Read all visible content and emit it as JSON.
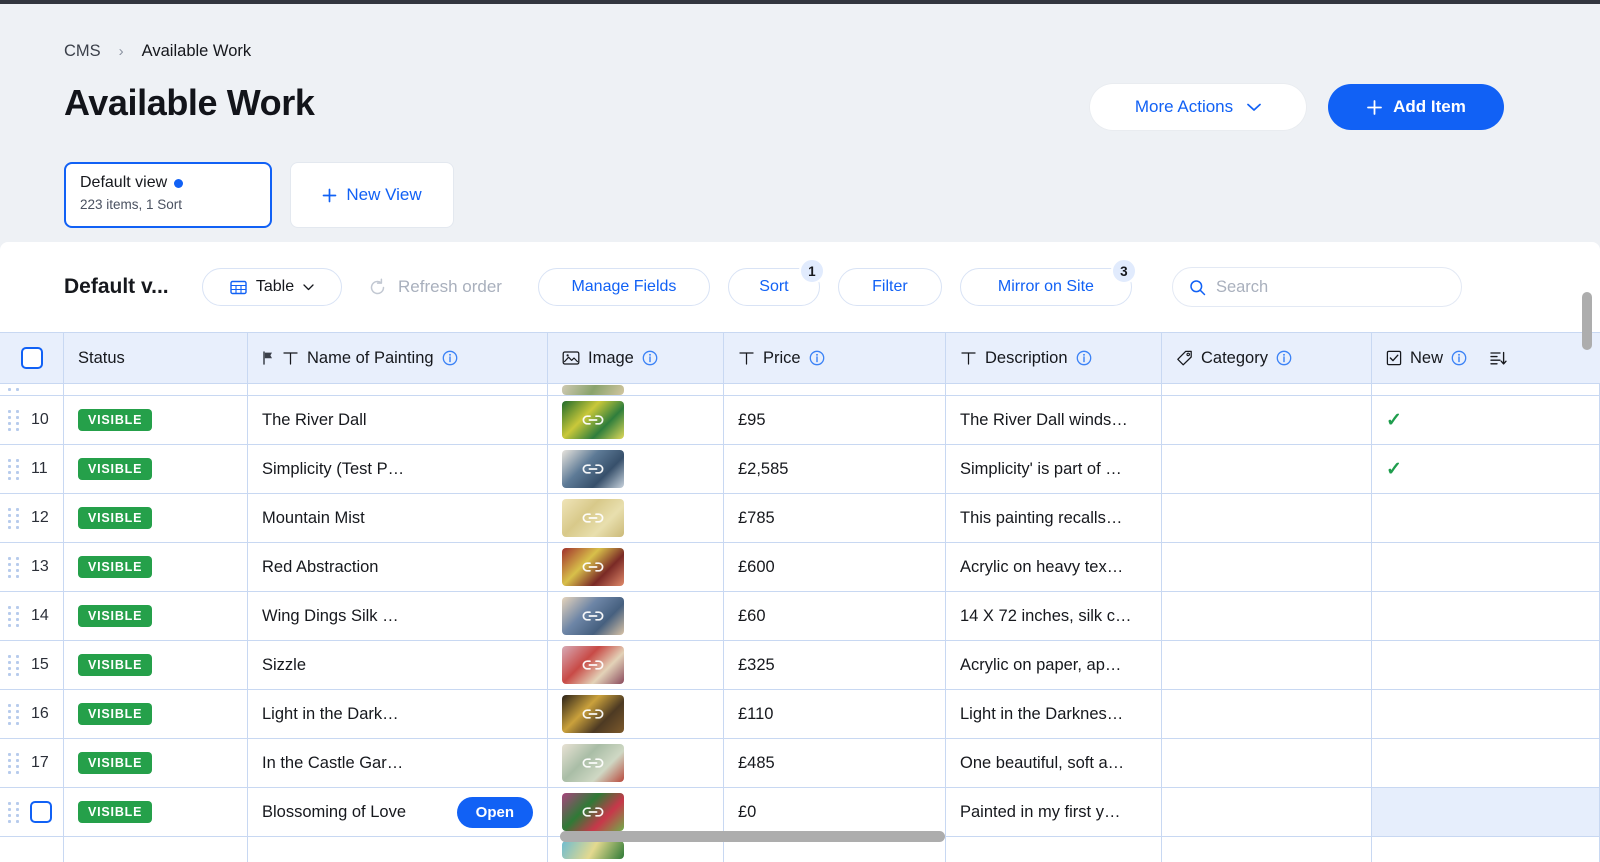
{
  "breadcrumb": {
    "root": "CMS",
    "current": "Available Work",
    "separator": "›"
  },
  "header": {
    "title": "Available Work",
    "more_actions_label": "More Actions",
    "add_item_label": "Add Item"
  },
  "views": {
    "default": {
      "name": "Default view",
      "subtitle": "223 items, 1 Sort"
    },
    "new_view_label": "New View"
  },
  "toolbar": {
    "view_name": "Default v...",
    "table_label": "Table",
    "refresh_label": "Refresh order",
    "manage_fields_label": "Manage Fields",
    "sort_label": "Sort",
    "sort_badge": "1",
    "filter_label": "Filter",
    "mirror_label": "Mirror on Site",
    "mirror_badge": "3",
    "search_placeholder": "Search",
    "search_value": ""
  },
  "columns": [
    {
      "key": "select",
      "label": "",
      "type_icon": "",
      "info": false,
      "sort_icon": false
    },
    {
      "key": "status",
      "label": "Status",
      "type_icon": "",
      "info": false,
      "sort_icon": false
    },
    {
      "key": "name",
      "label": "Name of Painting",
      "type_icon": "text-icon",
      "info": true,
      "sort_icon": false,
      "flag_icon": true
    },
    {
      "key": "image",
      "label": "Image",
      "type_icon": "image-icon",
      "info": true,
      "sort_icon": false
    },
    {
      "key": "price",
      "label": "Price",
      "type_icon": "text-icon",
      "info": true,
      "sort_icon": false
    },
    {
      "key": "description",
      "label": "Description",
      "type_icon": "text-icon",
      "info": true,
      "sort_icon": false
    },
    {
      "key": "category",
      "label": "Category",
      "type_icon": "tag-icon",
      "info": true,
      "sort_icon": false
    },
    {
      "key": "new",
      "label": "New",
      "type_icon": "checkbox-icon",
      "info": true,
      "sort_icon": true
    }
  ],
  "rows": [
    {
      "num": "10",
      "status": "VISIBLE",
      "name": "The River Dall",
      "price": "£95",
      "description": "The River Dall winds…",
      "category": "",
      "new": true,
      "thumb": [
        "#1f6a2a",
        "#c9c83a",
        "#2f7e3c",
        "#e0d95a"
      ],
      "open": false,
      "checkbox": false
    },
    {
      "num": "11",
      "status": "VISIBLE",
      "name": "Simplicity (Test P…",
      "price": "£2,585",
      "description": "Simplicity' is part of …",
      "category": "",
      "new": true,
      "thumb": [
        "#e8e4dd",
        "#5d7a96",
        "#37506b",
        "#c8d3dd"
      ],
      "open": false,
      "checkbox": false
    },
    {
      "num": "12",
      "status": "VISIBLE",
      "name": "Mountain Mist",
      "price": "£785",
      "description": "This painting recalls…",
      "category": "",
      "new": false,
      "thumb": [
        "#efe4b8",
        "#d8c98a",
        "#e8dfae",
        "#cbb978"
      ],
      "open": false,
      "checkbox": false
    },
    {
      "num": "13",
      "status": "VISIBLE",
      "name": "Red Abstraction",
      "price": "£600",
      "description": "Acrylic on heavy tex…",
      "category": "",
      "new": false,
      "thumb": [
        "#a0302c",
        "#d8c04a",
        "#7a2a26",
        "#e08a6a"
      ],
      "open": false,
      "checkbox": false
    },
    {
      "num": "14",
      "status": "VISIBLE",
      "name": "Wing Dings Silk …",
      "price": "£60",
      "description": "14 X 72 inches, silk c…",
      "category": "",
      "new": false,
      "thumb": [
        "#e6d4bc",
        "#6d85a6",
        "#46607f",
        "#d9c3a6"
      ],
      "open": false,
      "checkbox": false
    },
    {
      "num": "15",
      "status": "VISIBLE",
      "name": "Sizzle",
      "price": "£325",
      "description": "Acrylic on paper, ap…",
      "category": "",
      "new": false,
      "thumb": [
        "#d7abb6",
        "#c84a46",
        "#e3d2b8",
        "#8a4a5c"
      ],
      "open": false,
      "checkbox": false
    },
    {
      "num": "16",
      "status": "VISIBLE",
      "name": "Light in the Dark…",
      "price": "£110",
      "description": "Light in the Darknes…",
      "category": "",
      "new": false,
      "thumb": [
        "#2a2119",
        "#caa13c",
        "#4d3a23",
        "#7d5a2c"
      ],
      "open": false,
      "checkbox": false
    },
    {
      "num": "17",
      "status": "VISIBLE",
      "name": "In the Castle Gar…",
      "price": "£485",
      "description": "One beautiful, soft a…",
      "category": "",
      "new": false,
      "thumb": [
        "#e8e2d4",
        "#a9bda6",
        "#cfd8c4",
        "#b8483c"
      ],
      "open": false,
      "checkbox": false
    },
    {
      "num": "",
      "status": "VISIBLE",
      "name": "Blossoming of Love",
      "price": "£0",
      "description": "Painted in my first y…",
      "category": "",
      "new": false,
      "thumb": [
        "#a8457e",
        "#2f7a36",
        "#c8374a",
        "#6fae4a"
      ],
      "open": true,
      "open_label": "Open",
      "checkbox": true,
      "new_highlight": true
    }
  ]
}
